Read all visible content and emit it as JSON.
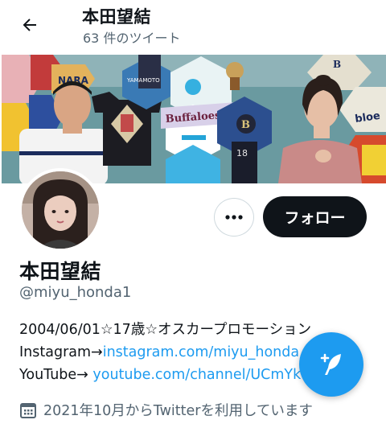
{
  "header": {
    "title": "本田望結",
    "tweet_count": "63 件のツイート"
  },
  "banner": {
    "texts": {
      "nara": "NARA",
      "yamamoto": "YAMAMOTO",
      "buffaloes": "Buffaloes Bu",
      "bloe": "bloe",
      "jersey_number": "18",
      "logo_letter": "B"
    }
  },
  "actions": {
    "follow_label": "フォロー"
  },
  "profile": {
    "name": "本田望結",
    "handle": "@miyu_honda1",
    "bio_line1": "2004/06/01☆17歳☆オスカープロモーション",
    "instagram_prefix": "Instagram→",
    "instagram_link": "instagram.com/miyu_honda",
    "youtube_prefix": "YouTube→ ",
    "youtube_link": "youtube.com/channel/UCmYk",
    "joined": "2021年10月からTwitterを利用しています"
  },
  "colors": {
    "accent": "#1d9bf0",
    "follow_bg": "#0f1419",
    "secondary_text": "#536471"
  },
  "icons": [
    "back-arrow-icon",
    "more-dots-icon",
    "calendar-icon",
    "compose-tweet-icon"
  ]
}
